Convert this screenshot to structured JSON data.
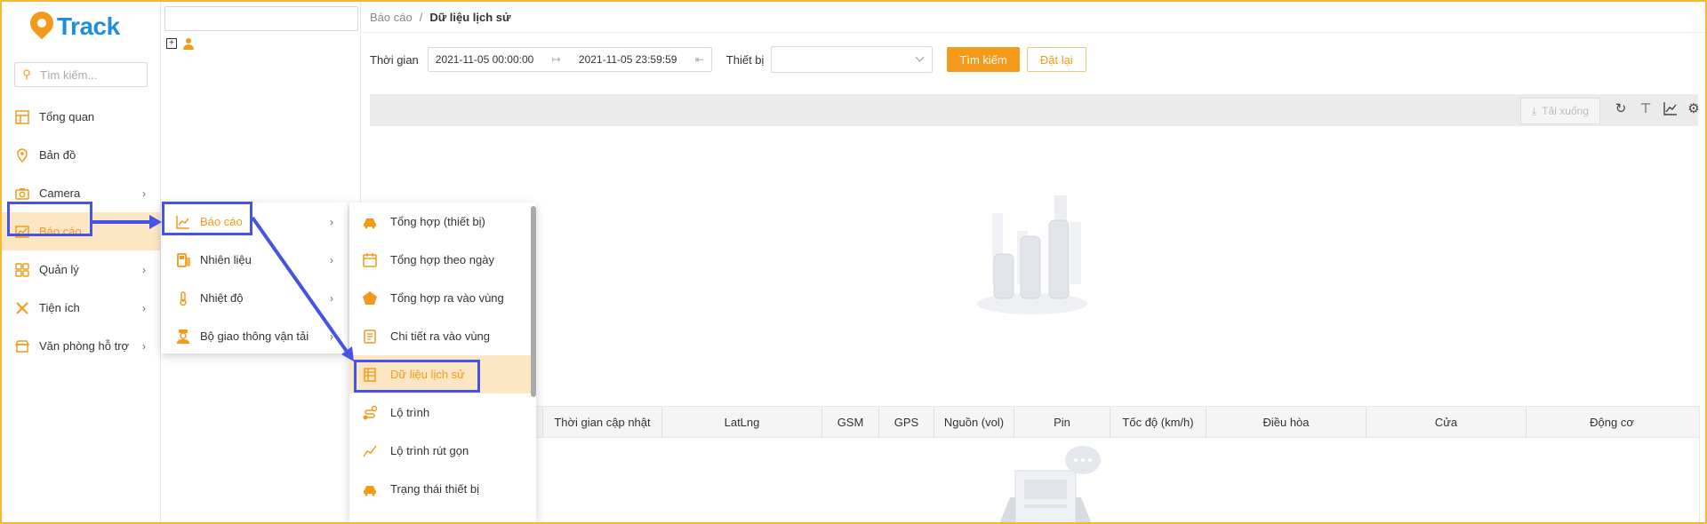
{
  "brand": {
    "logo_text": "Track"
  },
  "sidebar": {
    "search_placeholder": "Tìm kiếm...",
    "items": [
      {
        "label": "Tổng quan",
        "icon": "layout-icon"
      },
      {
        "label": "Bản đồ",
        "icon": "map-icon"
      },
      {
        "label": "Camera",
        "icon": "camera-icon"
      },
      {
        "label": "Báo cáo",
        "icon": "report-icon"
      },
      {
        "label": "Quản lý",
        "icon": "grid-icon"
      },
      {
        "label": "Tiện ích",
        "icon": "tools-icon"
      },
      {
        "label": "Văn phòng hỗ trợ",
        "icon": "store-icon"
      }
    ],
    "active_index": 3
  },
  "breadcrumb": {
    "parent": "Báo cáo",
    "separator": "/",
    "current": "Dữ liệu lịch sử"
  },
  "filters": {
    "time_label": "Thời gian",
    "start": "2021-11-05 00:00:00",
    "end": "2021-11-05 23:59:59",
    "device_label": "Thiết bị",
    "search_button": "Tìm kiếm",
    "reset_button": "Đặt lại"
  },
  "toolbar": {
    "download_label": "Tải xuống"
  },
  "table": {
    "columns": [
      "Thời gian cập nhật",
      "LatLng",
      "GSM",
      "GPS",
      "Nguồn (vol)",
      "Pin",
      "Tốc độ (km/h)",
      "Điều hòa",
      "Cửa",
      "Động cơ"
    ]
  },
  "submenu_level1": [
    {
      "label": "Báo cáo",
      "icon": "chart-line-icon"
    },
    {
      "label": "Nhiên liệu",
      "icon": "fuel-icon"
    },
    {
      "label": "Nhiệt độ",
      "icon": "thermometer-icon"
    },
    {
      "label": "Bộ giao thông vận tải",
      "icon": "officer-icon"
    }
  ],
  "submenu_level2": [
    {
      "label": "Tổng hợp (thiết bị)",
      "icon": "car-icon"
    },
    {
      "label": "Tổng hợp theo ngày",
      "icon": "calendar-icon"
    },
    {
      "label": "Tổng hợp ra vào vùng",
      "icon": "pentagon-icon"
    },
    {
      "label": "Chi tiết ra vào vùng",
      "icon": "document-icon"
    },
    {
      "label": "Dữ liệu lịch sử",
      "icon": "list-icon"
    },
    {
      "label": "Lộ trình",
      "icon": "route-icon"
    },
    {
      "label": "Lộ trình rút gọn",
      "icon": "trend-icon"
    },
    {
      "label": "Trạng thái thiết bị",
      "icon": "car-icon"
    }
  ],
  "colors": {
    "accent": "#f49a1a",
    "highlight": "#4553e6",
    "active_bg": "#fde6c3",
    "frame": "#f7b731"
  }
}
